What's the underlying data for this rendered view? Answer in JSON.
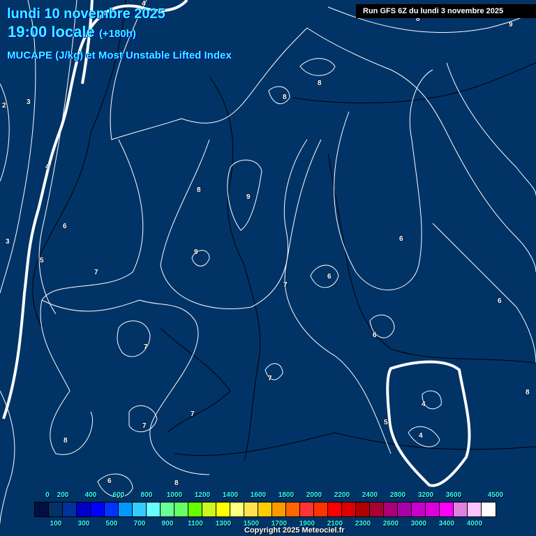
{
  "header": {
    "date": "lundi 10 novembre 2025",
    "time": "19:00 locale",
    "lead": "(+180h)",
    "parameter": "MUCAPE (J/kg) et Most Unstable Lifted Index",
    "run": "Run GFS 6Z du lundi 3 novembre 2025"
  },
  "colorbar": {
    "colors": [
      "#001040",
      "#023366",
      "#003399",
      "#0000cc",
      "#0000ff",
      "#0033ff",
      "#0099ff",
      "#33ccff",
      "#66ffff",
      "#66ff99",
      "#66ff66",
      "#66ff00",
      "#ccf71c",
      "#ffff00",
      "#ffff80",
      "#ffe44d",
      "#ffcc00",
      "#ff9900",
      "#ff6600",
      "#ff3333",
      "#ff3300",
      "#ff0000",
      "#dd0000",
      "#b00000",
      "#aa0033",
      "#aa0077",
      "#aa00aa",
      "#cc00cc",
      "#dd00dd",
      "#ff00ff",
      "#e080e0",
      "#ffc0ff",
      "#ffffff"
    ],
    "top_labels": [
      "0",
      "200",
      "400",
      "600",
      "800",
      "1000",
      "1200",
      "1400",
      "1600",
      "1800",
      "2000",
      "2200",
      "2400",
      "2800",
      "3200",
      "3600",
      "4500"
    ],
    "bottom_labels": [
      "100",
      "300",
      "500",
      "700",
      "900",
      "1100",
      "1300",
      "1500",
      "1700",
      "1900",
      "2100",
      "2300",
      "2600",
      "3000",
      "3400",
      "4000"
    ]
  },
  "contour_labels": [
    "4",
    "8",
    "9",
    "2",
    "3",
    "8",
    "8",
    "4",
    "8",
    "9",
    "6",
    "3",
    "6",
    "9",
    "5",
    "7",
    "7",
    "6",
    "6",
    "7",
    "6",
    "7",
    "8",
    "4",
    "5",
    "7",
    "7",
    "4",
    "8",
    "6",
    "8"
  ],
  "copyright": "Copyright 2025 Meteociel.fr"
}
